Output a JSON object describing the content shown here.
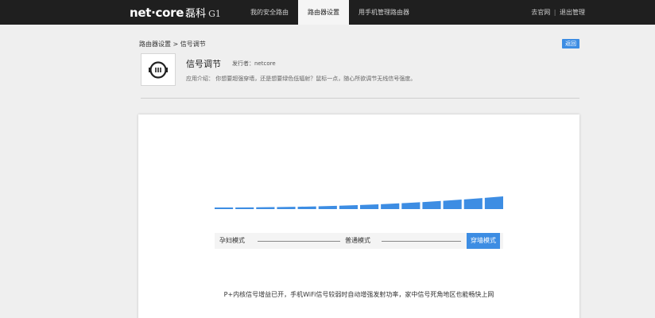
{
  "header": {
    "logo_brand": "net·core",
    "logo_cn": "磊科",
    "logo_model": "G1",
    "nav": [
      "我的安全路由",
      "路由器设置",
      "用手机管理路由器"
    ],
    "active_nav_index": 1,
    "links": {
      "official_site": "去官网",
      "separator": "|",
      "logout": "退出管理"
    }
  },
  "breadcrumb": {
    "parent": "路由器设置",
    "separator": ">",
    "current": "信号调节"
  },
  "back_button": "返回",
  "app": {
    "icon": "signal-adjust-icon",
    "title": "信号调节",
    "publisher": "发行者：netcore",
    "description": "应用介绍：   你想要超强穿墙，还是想要绿色低辐射？鼠标一点，随心所欲调节无线信号强度。"
  },
  "signal": {
    "levels": 14,
    "current_level": 14,
    "bar_color": "#3d8de3",
    "modes": [
      "孕妇模式",
      "普通模式",
      "穿墙模式"
    ],
    "selected_mode": "穿墙模式"
  },
  "tip": "P+内核信号增益已开，手机WiFi信号较弱时自动增强发射功率，家中信号死角地区也能畅快上网"
}
